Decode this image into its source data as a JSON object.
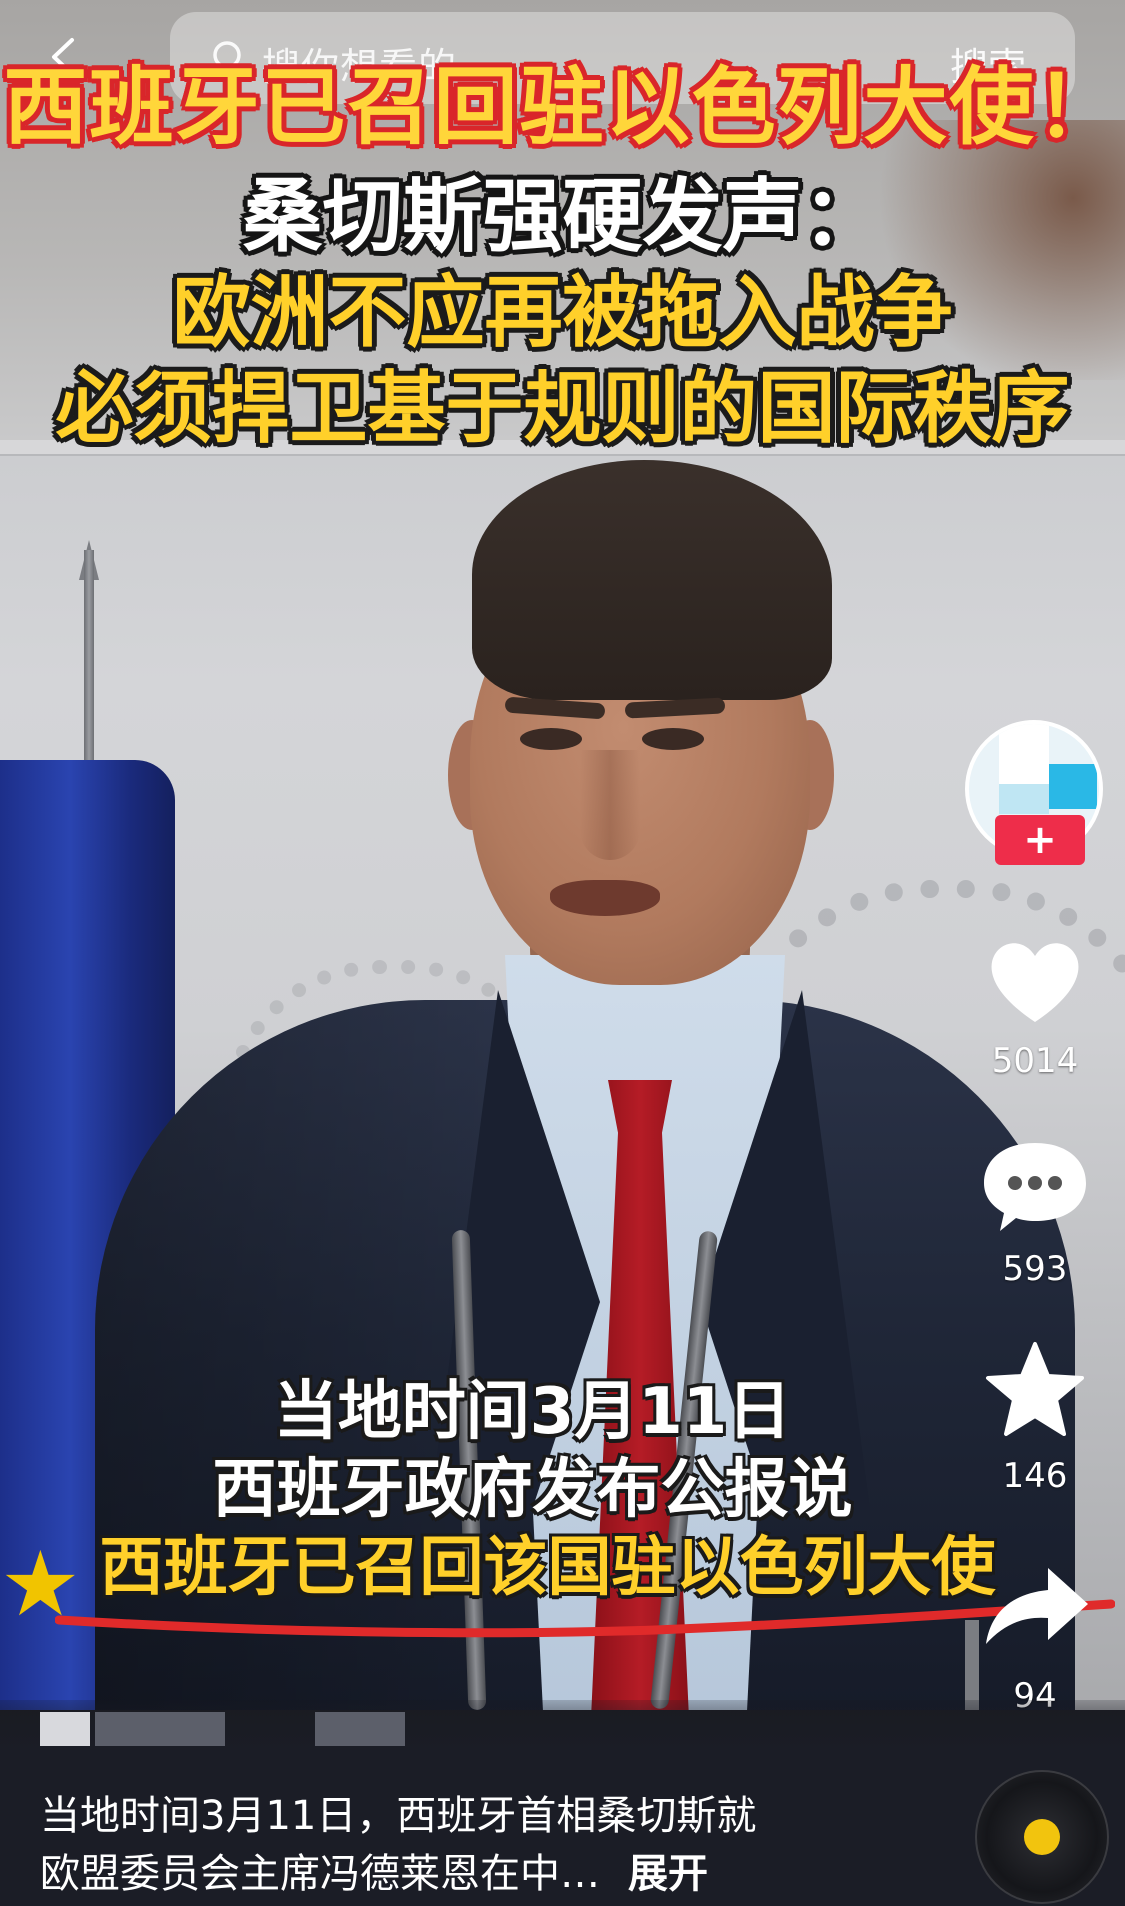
{
  "top_bar": {
    "search_placeholder": "搜你想看的",
    "search_button": "搜索"
  },
  "headline": {
    "line1": "西班牙已召回驻以色列大使！",
    "line2": "桑切斯强硬发声：",
    "line3": "欧洲不应再被拖入战争",
    "line4": "必须捍卫基于规则的国际秩序"
  },
  "subtitles": {
    "line1": "当地时间3月11日",
    "line2": "西班牙政府发布公报说",
    "line3": "西班牙已召回该国驻以色列大使"
  },
  "actions": {
    "follow": "+",
    "likes": "5014",
    "comments": "593",
    "favorites": "146",
    "shares": "94"
  },
  "description": {
    "line1": "当地时间3月11日，西班牙首相桑切斯就",
    "line2": "欧盟委员会主席冯德莱恩在中…",
    "expand": "展开"
  },
  "colors": {
    "headline_yellow": "#ffd02a",
    "headline_red_outline": "#d9262a",
    "follow_red": "#ee2d4a",
    "underline_red": "#e02a2a",
    "panel_bg": "#1b1d26"
  }
}
